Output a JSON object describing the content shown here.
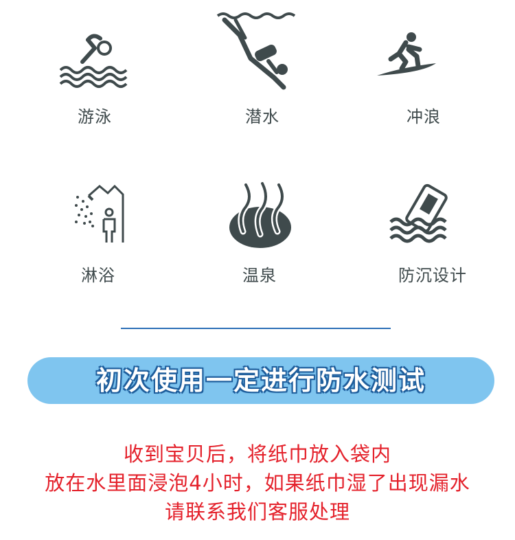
{
  "features": [
    {
      "label": "游泳",
      "icon": "swimming-icon"
    },
    {
      "label": "潜水",
      "icon": "diving-icon"
    },
    {
      "label": "冲浪",
      "icon": "surfing-icon"
    },
    {
      "label": "淋浴",
      "icon": "shower-icon"
    },
    {
      "label": "温泉",
      "icon": "hot-spring-icon"
    },
    {
      "label": "防沉设计",
      "icon": "anti-sink-icon"
    }
  ],
  "banner": {
    "text": "初次使用一定进行防水测试"
  },
  "notes": [
    "收到宝贝后，将纸巾放入袋内",
    "放在水里面浸泡4小时，如果纸巾湿了出现漏水",
    "请联系我们客服处理"
  ],
  "colors": {
    "icon": "#3f4a4c",
    "accent": "#2d6fb7",
    "banner": "#7fc5ef",
    "note": "#e4212b"
  }
}
